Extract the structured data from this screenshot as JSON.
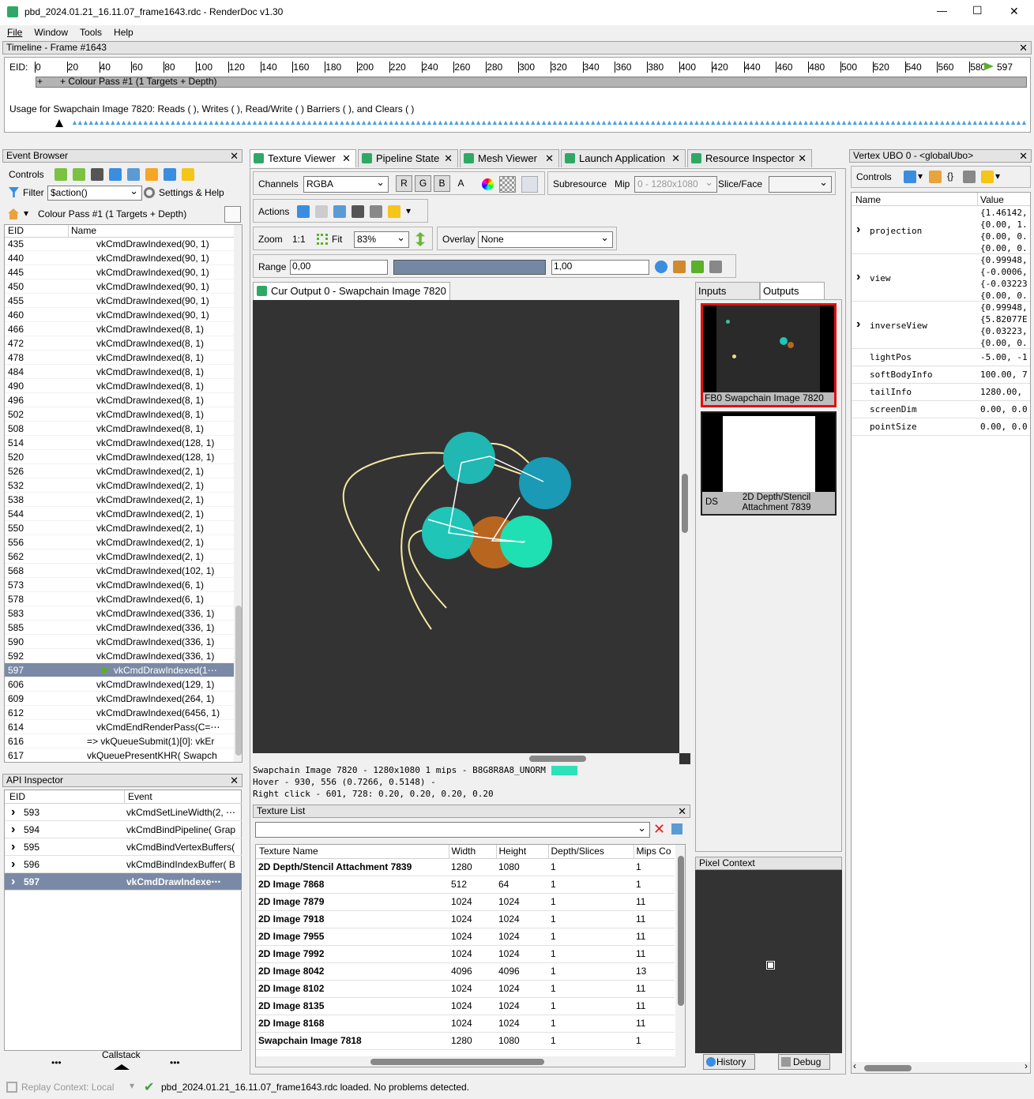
{
  "window": {
    "title": "pbd_2024.01.21_16.11.07_frame1643.rdc - RenderDoc v1.30",
    "min": "—",
    "max": "☐",
    "close": "✕"
  },
  "menu": [
    "File",
    "Window",
    "Tools",
    "Help"
  ],
  "timeline": {
    "title": "Timeline - Frame #1643",
    "eid_label": "EID:",
    "ticks": [
      "0",
      "20",
      "40",
      "60",
      "80",
      "100",
      "120",
      "140",
      "160",
      "180",
      "200",
      "220",
      "240",
      "260",
      "280",
      "300",
      "320",
      "340",
      "360",
      "380",
      "400",
      "420",
      "440",
      "460",
      "480",
      "500",
      "520",
      "540",
      "560",
      "580"
    ],
    "current": "597",
    "pass_label": "+ Colour Pass #1 (1 Targets + Depth)",
    "usage": "Usage for Swapchain Image 7820: Reads (  ), Writes (  ), Read/Write (  ) Barriers (  ), and Clears (  )"
  },
  "event_browser": {
    "title": "Event Browser",
    "controls": "Controls",
    "filter_label": "Filter",
    "filter_value": "$action()",
    "settings": "Settings & Help",
    "breadcrumb": "Colour Pass #1 (1 Targets + Depth)",
    "col_eid": "EID",
    "col_name": "Name",
    "rows": [
      [
        "435",
        "vkCmdDrawIndexed(90, 1)"
      ],
      [
        "440",
        "vkCmdDrawIndexed(90, 1)"
      ],
      [
        "445",
        "vkCmdDrawIndexed(90, 1)"
      ],
      [
        "450",
        "vkCmdDrawIndexed(90, 1)"
      ],
      [
        "455",
        "vkCmdDrawIndexed(90, 1)"
      ],
      [
        "460",
        "vkCmdDrawIndexed(90, 1)"
      ],
      [
        "466",
        "vkCmdDrawIndexed(8, 1)"
      ],
      [
        "472",
        "vkCmdDrawIndexed(8, 1)"
      ],
      [
        "478",
        "vkCmdDrawIndexed(8, 1)"
      ],
      [
        "484",
        "vkCmdDrawIndexed(8, 1)"
      ],
      [
        "490",
        "vkCmdDrawIndexed(8, 1)"
      ],
      [
        "496",
        "vkCmdDrawIndexed(8, 1)"
      ],
      [
        "502",
        "vkCmdDrawIndexed(8, 1)"
      ],
      [
        "508",
        "vkCmdDrawIndexed(8, 1)"
      ],
      [
        "514",
        "vkCmdDrawIndexed(128, 1)"
      ],
      [
        "520",
        "vkCmdDrawIndexed(128, 1)"
      ],
      [
        "526",
        "vkCmdDrawIndexed(2, 1)"
      ],
      [
        "532",
        "vkCmdDrawIndexed(2, 1)"
      ],
      [
        "538",
        "vkCmdDrawIndexed(2, 1)"
      ],
      [
        "544",
        "vkCmdDrawIndexed(2, 1)"
      ],
      [
        "550",
        "vkCmdDrawIndexed(2, 1)"
      ],
      [
        "556",
        "vkCmdDrawIndexed(2, 1)"
      ],
      [
        "562",
        "vkCmdDrawIndexed(2, 1)"
      ],
      [
        "568",
        "vkCmdDrawIndexed(102, 1)"
      ],
      [
        "573",
        "vkCmdDrawIndexed(6, 1)"
      ],
      [
        "578",
        "vkCmdDrawIndexed(6, 1)"
      ],
      [
        "583",
        "vkCmdDrawIndexed(336, 1)"
      ],
      [
        "585",
        "vkCmdDrawIndexed(336, 1)"
      ],
      [
        "590",
        "vkCmdDrawIndexed(336, 1)"
      ],
      [
        "592",
        "vkCmdDrawIndexed(336, 1)"
      ],
      [
        "597",
        "vkCmdDrawIndexed(1⋯"
      ],
      [
        "606",
        "vkCmdDrawIndexed(129, 1)"
      ],
      [
        "609",
        "vkCmdDrawIndexed(264, 1)"
      ],
      [
        "612",
        "vkCmdDrawIndexed(6456, 1)"
      ],
      [
        "614",
        "vkCmdEndRenderPass(C=⋯"
      ],
      [
        "616",
        "=>  vkQueueSubmit(1)[0]:  vkEr"
      ],
      [
        "617",
        "vkQueuePresentKHR( Swapch"
      ]
    ]
  },
  "api_inspector": {
    "title": "API Inspector",
    "col_eid": "EID",
    "col_event": "Event",
    "rows": [
      [
        "593",
        "vkCmdSetLineWidth(2, ⋯"
      ],
      [
        "594",
        "vkCmdBindPipeline( Grap"
      ],
      [
        "595",
        "vkCmdBindVertexBuffers("
      ],
      [
        "596",
        "vkCmdBindIndexBuffer( B"
      ],
      [
        "597",
        "vkCmdDrawIndexe⋯"
      ]
    ],
    "callstack": "Callstack",
    "dots": "•••"
  },
  "tabs": [
    "Texture Viewer",
    "Pipeline State",
    "Mesh Viewer",
    "Launch Application",
    "Resource Inspector"
  ],
  "texview": {
    "channels_label": "Channels",
    "channels": "RGBA",
    "r": "R",
    "g": "G",
    "b": "B",
    "a": "A",
    "subresource": "Subresource",
    "mip": "Mip",
    "mip_value": "0 - 1280x1080",
    "slice": "Slice/Face",
    "actions": "Actions",
    "zoom": "Zoom",
    "zoom_11": "1:1",
    "fit": "Fit",
    "zoom_value": "83%",
    "overlay": "Overlay",
    "overlay_value": "None",
    "range": "Range",
    "range_min": "0,00",
    "range_max": "1,00",
    "output_tab": "Cur Output 0 - Swapchain Image 7820",
    "status1": "Swapchain Image 7820 - 1280x1080 1 mips - B8G8R8A8_UNORM",
    "status2": "Hover -    930,  556 (0.7266, 0.5148)  -",
    "status3": "Right click -  601,  728: 0.20, 0.20, 0.20, 0.20",
    "pick_color": "#2de2b8"
  },
  "thumbs": {
    "inputs": "Inputs",
    "outputs": "Outputs",
    "fb0": "FB0  Swapchain Image 7820",
    "ds": "DS",
    "ds_name": "2D Depth/Stencil Attachment 7839"
  },
  "pixel_context": {
    "title": "Pixel Context",
    "history": "History",
    "debug": "Debug"
  },
  "texture_list": {
    "title": "Texture List",
    "cols": [
      "Texture Name",
      "Width",
      "Height",
      "Depth/Slices",
      "Mips Co"
    ],
    "rows": [
      [
        "2D Depth/Stencil Attachment 7839",
        "1280",
        "1080",
        "1",
        "1"
      ],
      [
        "2D Image 7868",
        "512",
        "64",
        "1",
        "1"
      ],
      [
        "2D Image 7879",
        "1024",
        "1024",
        "1",
        "11"
      ],
      [
        "2D Image 7918",
        "1024",
        "1024",
        "1",
        "11"
      ],
      [
        "2D Image 7955",
        "1024",
        "1024",
        "1",
        "11"
      ],
      [
        "2D Image 7992",
        "1024",
        "1024",
        "1",
        "11"
      ],
      [
        "2D Image 8042",
        "4096",
        "4096",
        "1",
        "13"
      ],
      [
        "2D Image 8102",
        "1024",
        "1024",
        "1",
        "11"
      ],
      [
        "2D Image 8135",
        "1024",
        "1024",
        "1",
        "11"
      ],
      [
        "2D Image 8168",
        "1024",
        "1024",
        "1",
        "11"
      ],
      [
        "Swapchain Image 7818",
        "1280",
        "1080",
        "1",
        "1"
      ]
    ]
  },
  "ubo": {
    "title": "Vertex UBO 0 - <globalUbo>",
    "controls": "Controls",
    "col_name": "Name",
    "col_value": "Value",
    "rows": [
      {
        "name": "projection",
        "values": [
          "{1.46142,",
          "{0.00, 1.",
          "{0.00, 0.",
          "{0.00, 0."
        ]
      },
      {
        "name": "view",
        "values": [
          "{0.99948,",
          "{-0.0006,",
          "{-0.03223",
          "{0.00, 0."
        ]
      },
      {
        "name": "inverseView",
        "values": [
          "{0.99948,",
          "{5.82077E",
          "{0.03223,",
          "{0.00, 0."
        ]
      }
    ],
    "simple": [
      [
        "lightPos",
        "-5.00, -1"
      ],
      [
        "softBodyInfo",
        "100.00, 7"
      ],
      [
        "tailInfo",
        "1280.00,"
      ],
      [
        "screenDim",
        "0.00, 0.0"
      ],
      [
        "pointSize",
        "0.00, 0.0"
      ]
    ]
  },
  "statusbar": {
    "replay": "Replay Context: Local",
    "message": "pbd_2024.01.21_16.11.07_frame1643.rdc loaded. No problems detected."
  }
}
